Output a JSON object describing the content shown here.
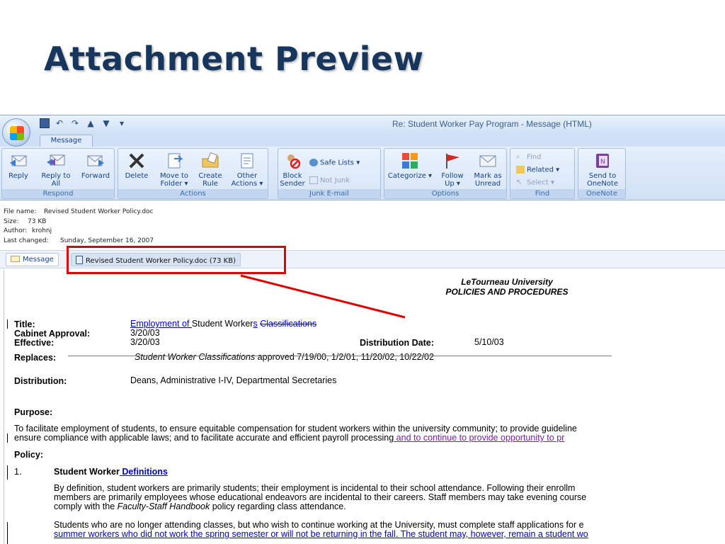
{
  "slide": {
    "title": "Attachment Preview"
  },
  "window": {
    "title": "Re: Student Worker Pay Program  -  Message (HTML)",
    "tab": "Message"
  },
  "ribbon": {
    "groups": {
      "respond": "Respond",
      "actions": "Actions",
      "junk": "Junk E-mail",
      "options": "Options",
      "find": "Find",
      "onenote": "OneNote"
    },
    "buttons": {
      "reply": "Reply",
      "reply_all": "Reply to All",
      "forward": "Forward",
      "delete": "Delete",
      "move_to_folder": "Move to Folder ▾",
      "create_rule": "Create Rule",
      "other_actions": "Other Actions ▾",
      "block_sender": "Block Sender",
      "safe_lists": "Safe Lists ▾",
      "not_junk": "Not Junk",
      "categorize": "Categorize ▾",
      "follow_up": "Follow Up ▾",
      "mark_as_unread": "Mark as Unread",
      "find": "Find",
      "related": "Related ▾",
      "select": "Select ▾",
      "send_to_onenote": "Send to OneNote"
    }
  },
  "file_info": {
    "name_label": "File name:",
    "name": "Revised Student Worker Policy.doc",
    "size_label": "Size:",
    "size": "73 KB",
    "author_label": "Author:",
    "author": "krohnj",
    "changed_label": "Last changed:",
    "changed": "Sunday, September 16, 2007"
  },
  "attachment_bar": {
    "message_tab": "Message",
    "attachment_tab": "Revised Student Worker Policy.doc (73 KB)"
  },
  "document": {
    "org": "LeTourneau University",
    "heading": "POLICIES AND PROCEDURES",
    "title_label": "Title:",
    "title_link": "Employment of ",
    "title_text": "Student Worker",
    "title_s": "s",
    "title_strike": "Classifications",
    "cabinet_label": "Cabinet Approval:",
    "cabinet_value": "3/20/03",
    "effective_label": "Effective:",
    "effective_value": "3/20/03",
    "distribution_date_label": "Distribution Date:",
    "distribution_date_value": "5/10/03",
    "replaces_label": "Replaces:",
    "replaces_italic": "Student Worker Classifications",
    "replaces_rest": " approved 7/19/00, 1/2/01, 11/20/02, 10/22/02",
    "distribution_label": "Distribution:",
    "distribution_value": "Deans, Administrative I-IV, Departmental Secretaries",
    "purpose_label": "Purpose:",
    "purpose_line1": "To facilitate employment of students, to ensure equitable compensation for student workers within the university community; to provide guideline",
    "purpose_line2a": "ensure compliance with applicable laws; and to facilitate accurate and efficient payroll processing",
    "purpose_line2b": " and to continue to provide opportunity to pr",
    "policy_label": "Policy:",
    "item_number": "1.",
    "item_title": "Student Worker",
    "item_title_link": " Definitions",
    "para1_line1": "By definition, student workers are primarily students; their employment is incidental to their school attendance.  Following their enrollm",
    "para1_line2": "members are primarily employees whose educational endeavors are incidental to their careers.  Staff members may take evening course",
    "para1_line3a": "comply with the ",
    "para1_line3b": "Faculty-Staff Handbook",
    "para1_line3c": " policy regarding class attendance.",
    "para2_line1": "Students who are no longer attending classes, but who wish to continue working at the University, must complete staff applications for e",
    "para2_line2": "summer workers who did not work the spring semester or will not be returning in the fall.  The student may, however, remain a student wo"
  },
  "colors": {
    "title": "#17365d",
    "annotation": "#e00000",
    "link": "#0000cc"
  }
}
